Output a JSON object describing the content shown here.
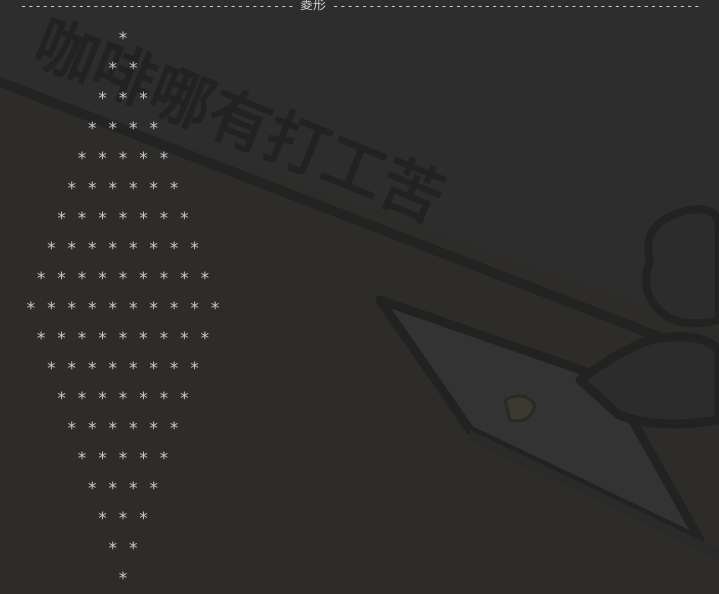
{
  "console": {
    "separator_left": "-----------------------------------------------",
    "separator_title": "菱形",
    "separator_right": "---------------------------------------------------------------",
    "lines": [
      "*",
      "* *",
      "* * *",
      "* * * *",
      "* * * * *",
      "* * * * * *",
      "* * * * * * *",
      "* * * * * * * *",
      "* * * * * * * * *",
      "* * * * * * * * * *",
      "* * * * * * * * *",
      "* * * * * * * *",
      "* * * * * * *",
      "* * * * * *",
      "* * * * *",
      "* * * *",
      "* * *",
      "* *",
      "*"
    ]
  },
  "wallpaper": {
    "text": "咖啡哪有打工苦",
    "colors": {
      "base": "#2b2b2b",
      "stroke": "#1f1f1f",
      "laptop_fill": "#3a3a3a"
    }
  }
}
